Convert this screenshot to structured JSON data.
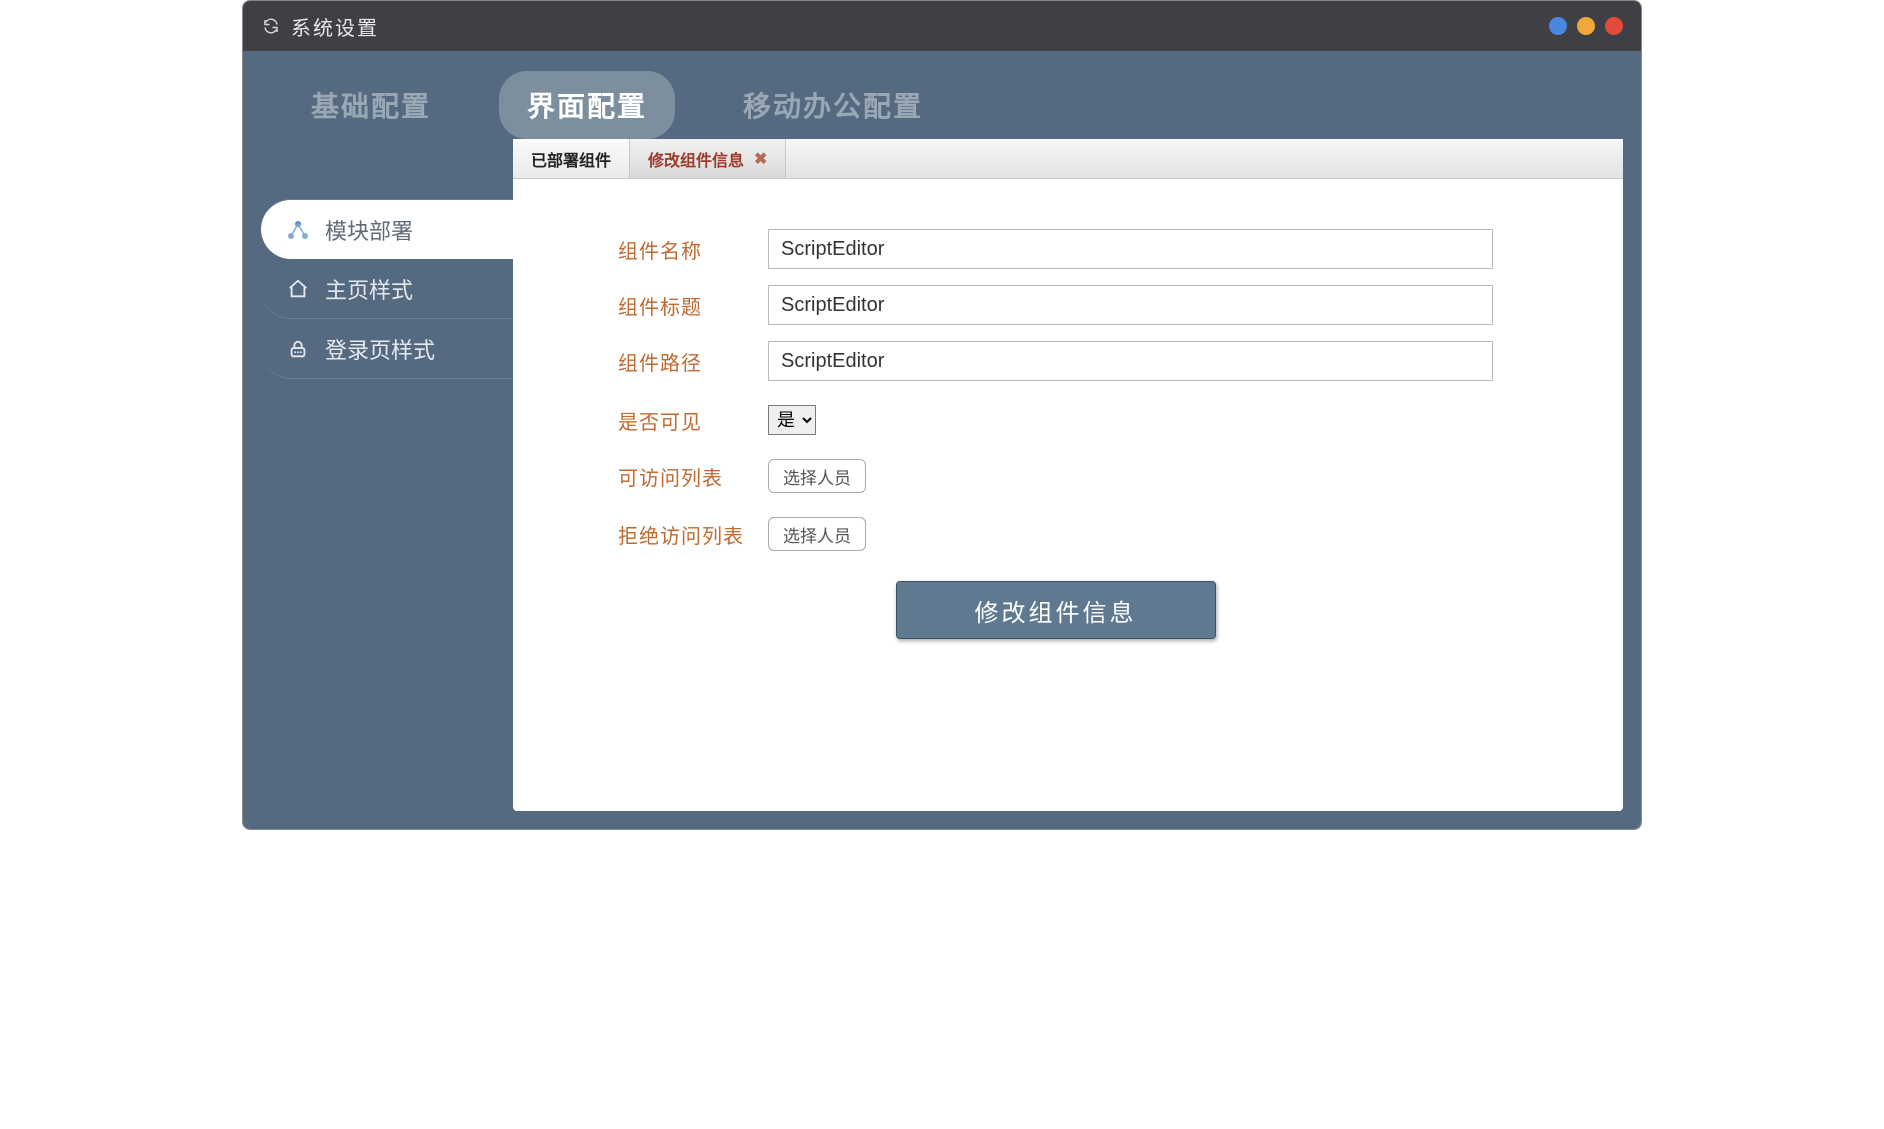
{
  "window": {
    "title": "系统设置"
  },
  "topTabs": [
    {
      "label": "基础配置",
      "active": false
    },
    {
      "label": "界面配置",
      "active": true
    },
    {
      "label": "移动办公配置",
      "active": false
    }
  ],
  "sidebar": {
    "items": [
      {
        "label": "模块部署",
        "active": true,
        "icon": "nodes"
      },
      {
        "label": "主页样式",
        "active": false,
        "icon": "home"
      },
      {
        "label": "登录页样式",
        "active": false,
        "icon": "lock"
      }
    ]
  },
  "contentTabs": [
    {
      "label": "已部署组件",
      "active": false,
      "closable": false
    },
    {
      "label": "修改组件信息",
      "active": true,
      "closable": true
    }
  ],
  "form": {
    "fields": {
      "name": {
        "label": "组件名称",
        "value": "ScriptEditor"
      },
      "title": {
        "label": "组件标题",
        "value": "ScriptEditor"
      },
      "path": {
        "label": "组件路径",
        "value": "ScriptEditor"
      },
      "visible": {
        "label": "是否可见",
        "value": "是"
      },
      "allow": {
        "label": "可访问列表",
        "button": "选择人员"
      },
      "deny": {
        "label": "拒绝访问列表",
        "button": "选择人员"
      }
    },
    "submit": "修改组件信息"
  },
  "closeGlyph": "✖"
}
